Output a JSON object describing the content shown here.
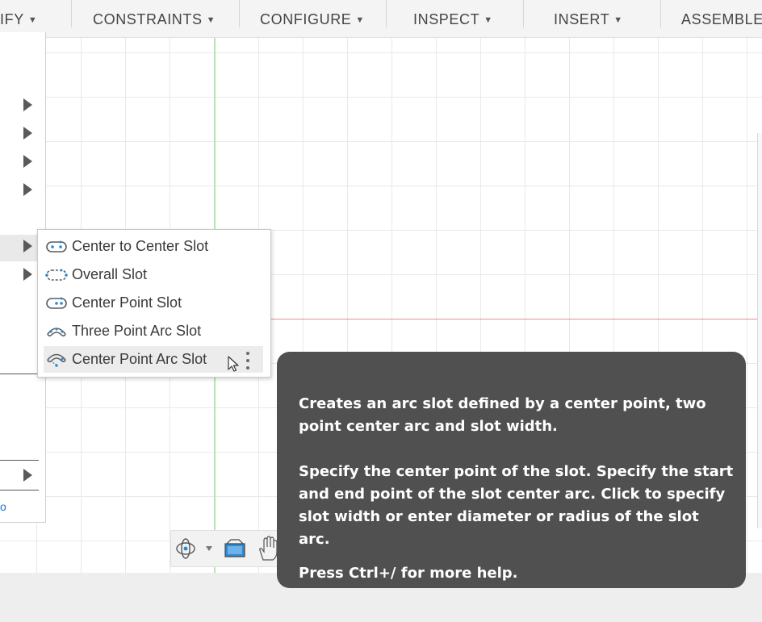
{
  "toolbar": {
    "items": [
      {
        "label": "IFY",
        "has_menu": true
      },
      {
        "label": "CONSTRAINTS",
        "has_menu": true
      },
      {
        "label": "CONFIGURE",
        "has_menu": true
      },
      {
        "label": "INSPECT",
        "has_menu": true
      },
      {
        "label": "INSERT",
        "has_menu": true
      },
      {
        "label": "ASSEMBLE",
        "has_menu": false
      }
    ],
    "caret": "▼"
  },
  "slot_menu": {
    "items": [
      {
        "label": "Center to Center Slot",
        "icon": "center-to-center-slot-icon"
      },
      {
        "label": "Overall Slot",
        "icon": "overall-slot-icon"
      },
      {
        "label": "Center Point Slot",
        "icon": "center-point-slot-icon"
      },
      {
        "label": "Three Point Arc Slot",
        "icon": "three-point-arc-slot-icon"
      },
      {
        "label": "Center Point Arc Slot",
        "icon": "center-point-arc-slot-icon",
        "highlighted": true
      }
    ]
  },
  "tooltip": {
    "description": "Creates an arc slot defined by a center point, two point center arc and slot width.",
    "instructions": "Specify the center point of the slot. Specify the start and end point of the slot center arc. Click to specify slot width or enter diameter or radius of the slot arc.",
    "help_hint": "Press Ctrl+/ for more help."
  },
  "left_menu": {
    "partial_text": "o"
  },
  "colors": {
    "icon_blue": "#2a8ad4",
    "tooltip_bg": "#505050",
    "axis_green": "#b6e6b0",
    "axis_red": "#e58f95"
  }
}
